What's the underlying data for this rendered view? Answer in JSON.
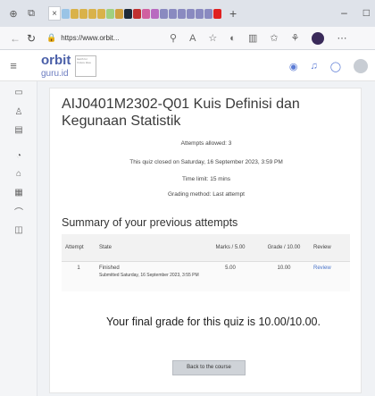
{
  "browser": {
    "url": "https://www.orbit...",
    "tab_colors": [
      "#9ac4e6",
      "#d9b24a",
      "#d9b24a",
      "#d9b24a",
      "#d9b24a",
      "#a0d080",
      "#d0a040",
      "#1e2a3a",
      "#c03030",
      "#d060a0",
      "#b86ac0",
      "#8a8ac0",
      "#8a8ac0",
      "#8a8ac0",
      "#8a8ac0",
      "#8a8ac0",
      "#8a8ac0",
      "#e02020"
    ]
  },
  "site": {
    "logo_main": "orbit",
    "logo_sub": "guru.id",
    "logo_tagline": "Earth for Future Idea"
  },
  "quiz": {
    "title": "AIJ0401M2302-Q01 Kuis Definisi dan Kegunaan Statistik",
    "attempts_allowed": "Attempts allowed: 3",
    "closed_on": "This quiz closed on Saturday, 16 September 2023, 3:59 PM",
    "time_limit": "Time limit: 15 mins",
    "grading_method": "Grading method: Last attempt",
    "summary_heading": "Summary of your previous attempts",
    "table": {
      "headers": [
        "Attempt",
        "State",
        "Marks / 5.00",
        "Grade / 10.00",
        "Review"
      ],
      "rows": [
        {
          "attempt": "1",
          "state": "Finished",
          "submitted": "Submitted Saturday, 16 September 2023, 3:55 PM",
          "marks": "5.00",
          "grade": "10.00",
          "review": "Review"
        }
      ]
    },
    "final_grade": "Your final grade for this quiz is 10.00/10.00.",
    "back_button": "Back to the course"
  }
}
